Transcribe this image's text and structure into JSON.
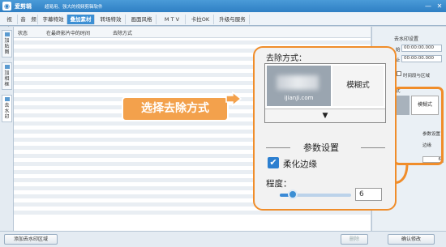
{
  "titlebar": {
    "app_name": "爱剪辑",
    "subtitle": "超易用、强大的视频剪辑软件",
    "minimize": "—",
    "close": "✕"
  },
  "menu": {
    "items": [
      {
        "label": "视　频"
      },
      {
        "label": "音　频"
      },
      {
        "label": "字幕特效"
      },
      {
        "label": "叠加素材"
      },
      {
        "label": "转场特效"
      },
      {
        "label": "画面风格"
      },
      {
        "label": "M T V"
      },
      {
        "label": "卡拉OK"
      },
      {
        "label": "升级与服务"
      }
    ],
    "active_index": 3
  },
  "left_tabs": [
    {
      "label": "加贴图"
    },
    {
      "label": "加相框"
    },
    {
      "label": "去水印"
    }
  ],
  "list": {
    "columns": [
      "状态",
      "在最终影片中的时间",
      "去除方式"
    ]
  },
  "right_panel": {
    "title": "去水印设置",
    "start_prefix": "始",
    "start_time": "00:00:00.000",
    "end_prefix": "止",
    "end_time": "00:00:00.000",
    "range_label": "时间段与区域",
    "method_prefix": "式",
    "mini_label": "模糊式",
    "params_label": "参数设置",
    "edge_label": "边缘",
    "value": "6"
  },
  "callout": {
    "title": "去除方式：",
    "watermark_text": "iJianJi.com",
    "blur_option": "模糊式",
    "dropdown_arrow": "▼",
    "section_title": "参数设置",
    "soft_edge_label": "柔化边缘",
    "soft_edge_checked": true,
    "degree_label": "程度：",
    "degree_value": "6",
    "degree_fraction": 0.18,
    "orange_label": "选择去除方式"
  },
  "bottom": {
    "add_button": "添加去水印区域",
    "delete_button": "删除",
    "confirm_button": "确认修改"
  },
  "colors": {
    "accent": "#3b8fd4",
    "highlight": "#f08d2a",
    "label_bg": "#f3a14c"
  }
}
